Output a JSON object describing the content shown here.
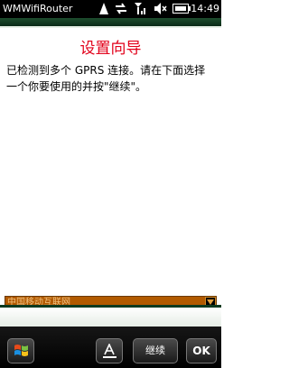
{
  "titlebar": {
    "app_title": "WMWifiRouter",
    "clock": "14:49",
    "icons": [
      "signal-strength-icon",
      "data-transfer-icon",
      "network-signal-icon",
      "volume-mute-icon",
      "battery-icon"
    ]
  },
  "page": {
    "title": "设置向导",
    "description": "已检测到多个 GPRS 连接。请在下面选择一个你要使用的并按\"继续\"。"
  },
  "connection_select": {
    "selected": "中国移动互联网"
  },
  "softkeys": {
    "start_icon": "windows-start-icon",
    "keyboard_icon": "keyboard-icon",
    "continue_label": "继续",
    "ok_label": "OK"
  },
  "colors": {
    "title_red": "#e2001a",
    "header_green": "#0e3a1f",
    "dropdown_bg": "#b25a00"
  }
}
